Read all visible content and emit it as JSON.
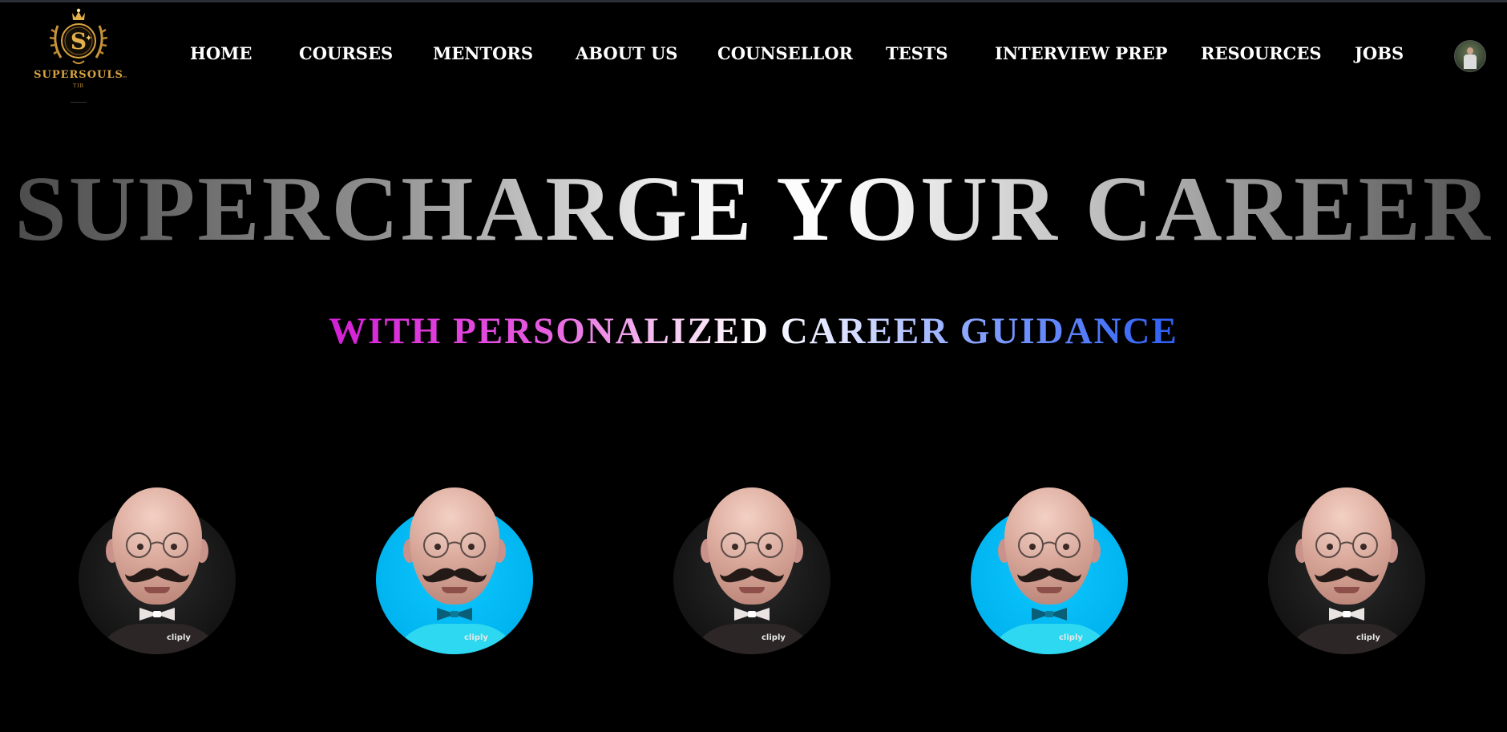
{
  "brand": {
    "name": "SUPERSOULS",
    "tagline": "TIB"
  },
  "nav": {
    "items": [
      {
        "label": "HOME"
      },
      {
        "label": "COURSES"
      },
      {
        "label": "MENTORS"
      },
      {
        "label": "ABOUT US"
      },
      {
        "label": "COUNSELLOR"
      },
      {
        "label": "TESTS"
      },
      {
        "label": "INTERVIEW PREP"
      },
      {
        "label": "RESOURCES"
      },
      {
        "label": "JOBS"
      }
    ],
    "profile_icon": "user-avatar"
  },
  "hero": {
    "title": "SUPERCHARGE YOUR CAREER",
    "subtitle": "WITH PERSONALIZED CAREER GUIDANCE"
  },
  "mentors": {
    "items": [
      {
        "style": "dark",
        "brand_text": "cliply"
      },
      {
        "style": "blue",
        "brand_text": "cliply"
      },
      {
        "style": "dark",
        "brand_text": "cliply"
      },
      {
        "style": "blue",
        "brand_text": "cliply"
      },
      {
        "style": "dark",
        "brand_text": "cliply"
      }
    ]
  },
  "colors": {
    "background": "#000000",
    "logo_gold": "#d9a441",
    "subtitle_pink": "#d41fd6",
    "subtitle_blue": "#2b5ef5",
    "mentor_blue_bg": "#00b4f0",
    "mentor_dark_bg": "#1a1a1a"
  }
}
